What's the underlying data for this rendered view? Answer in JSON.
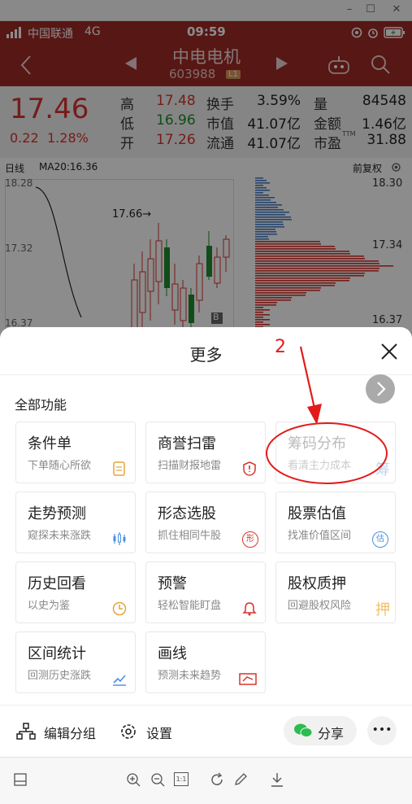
{
  "window": {
    "min": "–",
    "max": "☐",
    "close": "✕"
  },
  "status": {
    "carrier": "中国联通",
    "network": "4G",
    "time": "09:59"
  },
  "header": {
    "name": "中电电机",
    "code": "603988",
    "level": "L1"
  },
  "quote": {
    "price": "17.46",
    "change": "0.22",
    "change_pct": "1.28%",
    "high_label": "高",
    "high": "17.48",
    "low_label": "低",
    "low": "16.96",
    "open_label": "开",
    "open": "17.26",
    "turnover_label": "换手",
    "turnover": "3.59%",
    "mktcap_label": "市值",
    "mktcap": "41.07亿",
    "float_label": "流通",
    "float": "41.07亿",
    "vol_label": "量",
    "vol": "84548",
    "amount_label": "金额",
    "amount": "1.46亿",
    "pe_label": "市盈",
    "pe_sup": "TTM",
    "pe": "31.88"
  },
  "chart": {
    "period": "日线",
    "ma": "MA20:16.36",
    "adjust": "前复权",
    "left_top": "18.28",
    "left_mid": "17.32",
    "left_bot": "16.37",
    "marker": "17.66→",
    "b_marker": "B",
    "right_top": "18.30",
    "right_mid": "17.34",
    "right_bot": "16.37"
  },
  "sheet": {
    "title": "更多",
    "section": "全部功能",
    "annotation_number": "2",
    "cards": [
      {
        "title": "条件单",
        "sub": "下单随心所欲"
      },
      {
        "title": "商誉扫雷",
        "sub": "扫描财报地雷"
      },
      {
        "title": "筹码分布",
        "sub": "看清主力成本",
        "glyph": "筹"
      },
      {
        "title": "走势预测",
        "sub": "窥探未来涨跌"
      },
      {
        "title": "形态选股",
        "sub": "抓住相同牛股",
        "glyph": "形"
      },
      {
        "title": "股票估值",
        "sub": "找准价值区间",
        "glyph": "估"
      },
      {
        "title": "历史回看",
        "sub": "以史为鉴"
      },
      {
        "title": "预警",
        "sub": "轻松智能盯盘"
      },
      {
        "title": "股权质押",
        "sub": "回避股权风险",
        "glyph": "押"
      },
      {
        "title": "区间统计",
        "sub": "回测历史涨跌"
      },
      {
        "title": "画线",
        "sub": "预测未来趋势"
      }
    ],
    "edit_group": "编辑分组",
    "settings": "设置",
    "share": "分享",
    "more": "•••"
  },
  "toolbar": {
    "zoom_reset": "1:1"
  },
  "colors": {
    "brand": "#9e2a25",
    "up": "#d8342c",
    "down": "#1f8a2e",
    "annot": "#e31b1b"
  }
}
